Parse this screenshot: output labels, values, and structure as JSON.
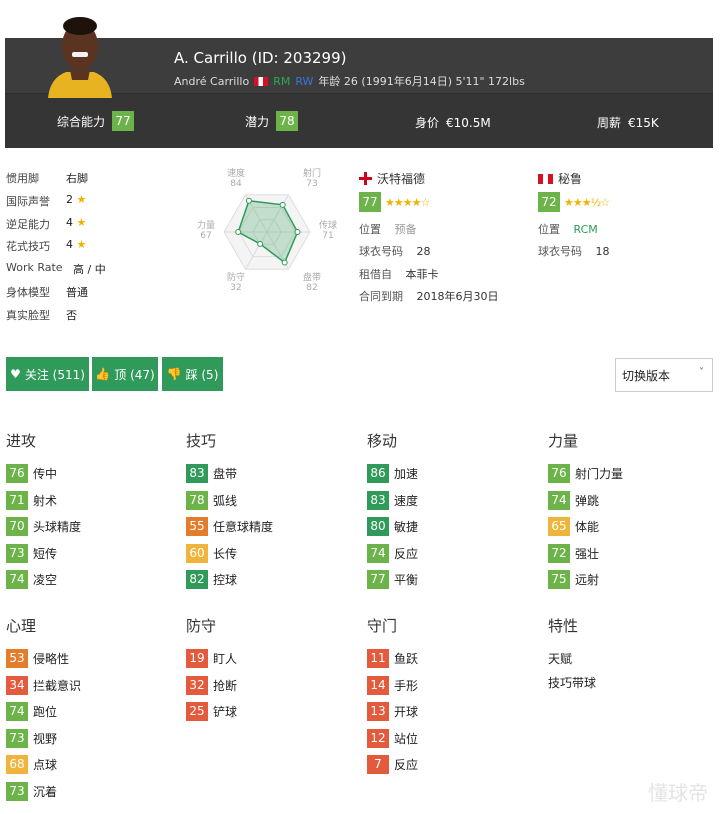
{
  "header": {
    "name": "A. Carrillo (ID: 203299)",
    "fullname": "André Carrillo",
    "pos1": "RM",
    "pos2": "RW",
    "bio": "年龄 26 (1991年6月14日) 5'11\" 172lbs",
    "overall_label": "综合能力",
    "overall": "77",
    "potential_label": "潜力",
    "potential": "78",
    "value_label": "身价",
    "value": "€10.5M",
    "wage_label": "周薪",
    "wage": "€15K"
  },
  "info": [
    {
      "k": "惯用脚",
      "v": "右脚"
    },
    {
      "k": "国际声誉",
      "v": "2",
      "star": true
    },
    {
      "k": "逆足能力",
      "v": "4",
      "star": true
    },
    {
      "k": "花式技巧",
      "v": "4",
      "star": true
    },
    {
      "k": "Work Rate",
      "v": "高 / 中"
    },
    {
      "k": "身体模型",
      "v": "普通"
    },
    {
      "k": "真实脸型",
      "v": "否"
    }
  ],
  "radar": {
    "labels": [
      "速度",
      "射门",
      "传球",
      "盘带",
      "防守",
      "力量"
    ],
    "values": [
      84,
      73,
      71,
      82,
      32,
      67
    ]
  },
  "club": {
    "name": "沃特福德",
    "rating": "77",
    "stars": "★★★★☆",
    "pos_label": "位置",
    "pos": "预备",
    "num_label": "球衣号码",
    "num": "28",
    "loan_label": "租借自",
    "loan": "本菲卡",
    "contract_label": "合同到期",
    "contract": "2018年6月30日"
  },
  "nation": {
    "name": "秘鲁",
    "rating": "72",
    "stars": "★★★½☆",
    "pos_label": "位置",
    "pos": "RCM",
    "num_label": "球衣号码",
    "num": "18"
  },
  "buttons": {
    "follow": "关注 (511)",
    "like": "顶 (47)",
    "dislike": "踩 (5)",
    "version": "切换版本"
  },
  "sections": [
    {
      "title": "进攻",
      "items": [
        [
          "76",
          "传中"
        ],
        [
          "71",
          "射术"
        ],
        [
          "70",
          "头球精度"
        ],
        [
          "73",
          "短传"
        ],
        [
          "74",
          "凌空"
        ]
      ]
    },
    {
      "title": "技巧",
      "items": [
        [
          "83",
          "盘带"
        ],
        [
          "78",
          "弧线"
        ],
        [
          "55",
          "任意球精度"
        ],
        [
          "60",
          "长传"
        ],
        [
          "82",
          "控球"
        ]
      ]
    },
    {
      "title": "移动",
      "items": [
        [
          "86",
          "加速"
        ],
        [
          "83",
          "速度"
        ],
        [
          "80",
          "敏捷"
        ],
        [
          "74",
          "反应"
        ],
        [
          "77",
          "平衡"
        ]
      ]
    },
    {
      "title": "力量",
      "items": [
        [
          "76",
          "射门力量"
        ],
        [
          "74",
          "弹跳"
        ],
        [
          "65",
          "体能"
        ],
        [
          "72",
          "强壮"
        ],
        [
          "75",
          "远射"
        ]
      ]
    },
    {
      "title": "心理",
      "items": [
        [
          "53",
          "侵略性"
        ],
        [
          "34",
          "拦截意识"
        ],
        [
          "74",
          "跑位"
        ],
        [
          "73",
          "视野"
        ],
        [
          "68",
          "点球"
        ],
        [
          "73",
          "沉着"
        ]
      ]
    },
    {
      "title": "防守",
      "items": [
        [
          "19",
          "盯人"
        ],
        [
          "32",
          "抢断"
        ],
        [
          "25",
          "铲球"
        ]
      ]
    },
    {
      "title": "守门",
      "items": [
        [
          "11",
          "鱼跃"
        ],
        [
          "14",
          "手形"
        ],
        [
          "13",
          "开球"
        ],
        [
          "12",
          "站位"
        ],
        [
          "7",
          "反应"
        ]
      ]
    },
    {
      "title": "特性",
      "items": []
    }
  ],
  "traits": [
    "天赋",
    "技巧带球"
  ],
  "watermark": "懂球帝"
}
